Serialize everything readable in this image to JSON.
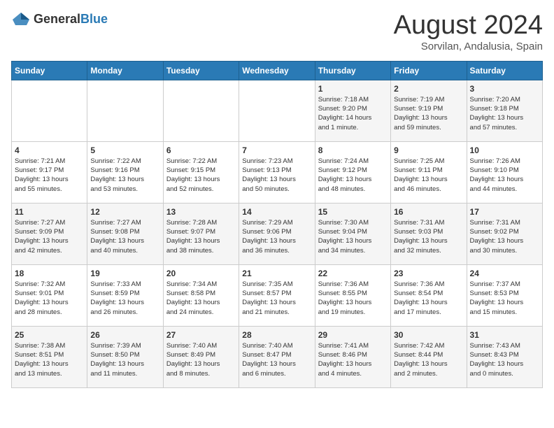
{
  "logo": {
    "text_general": "General",
    "text_blue": "Blue"
  },
  "title": "August 2024",
  "subtitle": "Sorvilan, Andalusia, Spain",
  "days_of_week": [
    "Sunday",
    "Monday",
    "Tuesday",
    "Wednesday",
    "Thursday",
    "Friday",
    "Saturday"
  ],
  "weeks": [
    [
      {
        "day": "",
        "info": ""
      },
      {
        "day": "",
        "info": ""
      },
      {
        "day": "",
        "info": ""
      },
      {
        "day": "",
        "info": ""
      },
      {
        "day": "1",
        "info": "Sunrise: 7:18 AM\nSunset: 9:20 PM\nDaylight: 14 hours\nand 1 minute."
      },
      {
        "day": "2",
        "info": "Sunrise: 7:19 AM\nSunset: 9:19 PM\nDaylight: 13 hours\nand 59 minutes."
      },
      {
        "day": "3",
        "info": "Sunrise: 7:20 AM\nSunset: 9:18 PM\nDaylight: 13 hours\nand 57 minutes."
      }
    ],
    [
      {
        "day": "4",
        "info": "Sunrise: 7:21 AM\nSunset: 9:17 PM\nDaylight: 13 hours\nand 55 minutes."
      },
      {
        "day": "5",
        "info": "Sunrise: 7:22 AM\nSunset: 9:16 PM\nDaylight: 13 hours\nand 53 minutes."
      },
      {
        "day": "6",
        "info": "Sunrise: 7:22 AM\nSunset: 9:15 PM\nDaylight: 13 hours\nand 52 minutes."
      },
      {
        "day": "7",
        "info": "Sunrise: 7:23 AM\nSunset: 9:13 PM\nDaylight: 13 hours\nand 50 minutes."
      },
      {
        "day": "8",
        "info": "Sunrise: 7:24 AM\nSunset: 9:12 PM\nDaylight: 13 hours\nand 48 minutes."
      },
      {
        "day": "9",
        "info": "Sunrise: 7:25 AM\nSunset: 9:11 PM\nDaylight: 13 hours\nand 46 minutes."
      },
      {
        "day": "10",
        "info": "Sunrise: 7:26 AM\nSunset: 9:10 PM\nDaylight: 13 hours\nand 44 minutes."
      }
    ],
    [
      {
        "day": "11",
        "info": "Sunrise: 7:27 AM\nSunset: 9:09 PM\nDaylight: 13 hours\nand 42 minutes."
      },
      {
        "day": "12",
        "info": "Sunrise: 7:27 AM\nSunset: 9:08 PM\nDaylight: 13 hours\nand 40 minutes."
      },
      {
        "day": "13",
        "info": "Sunrise: 7:28 AM\nSunset: 9:07 PM\nDaylight: 13 hours\nand 38 minutes."
      },
      {
        "day": "14",
        "info": "Sunrise: 7:29 AM\nSunset: 9:06 PM\nDaylight: 13 hours\nand 36 minutes."
      },
      {
        "day": "15",
        "info": "Sunrise: 7:30 AM\nSunset: 9:04 PM\nDaylight: 13 hours\nand 34 minutes."
      },
      {
        "day": "16",
        "info": "Sunrise: 7:31 AM\nSunset: 9:03 PM\nDaylight: 13 hours\nand 32 minutes."
      },
      {
        "day": "17",
        "info": "Sunrise: 7:31 AM\nSunset: 9:02 PM\nDaylight: 13 hours\nand 30 minutes."
      }
    ],
    [
      {
        "day": "18",
        "info": "Sunrise: 7:32 AM\nSunset: 9:01 PM\nDaylight: 13 hours\nand 28 minutes."
      },
      {
        "day": "19",
        "info": "Sunrise: 7:33 AM\nSunset: 8:59 PM\nDaylight: 13 hours\nand 26 minutes."
      },
      {
        "day": "20",
        "info": "Sunrise: 7:34 AM\nSunset: 8:58 PM\nDaylight: 13 hours\nand 24 minutes."
      },
      {
        "day": "21",
        "info": "Sunrise: 7:35 AM\nSunset: 8:57 PM\nDaylight: 13 hours\nand 21 minutes."
      },
      {
        "day": "22",
        "info": "Sunrise: 7:36 AM\nSunset: 8:55 PM\nDaylight: 13 hours\nand 19 minutes."
      },
      {
        "day": "23",
        "info": "Sunrise: 7:36 AM\nSunset: 8:54 PM\nDaylight: 13 hours\nand 17 minutes."
      },
      {
        "day": "24",
        "info": "Sunrise: 7:37 AM\nSunset: 8:53 PM\nDaylight: 13 hours\nand 15 minutes."
      }
    ],
    [
      {
        "day": "25",
        "info": "Sunrise: 7:38 AM\nSunset: 8:51 PM\nDaylight: 13 hours\nand 13 minutes."
      },
      {
        "day": "26",
        "info": "Sunrise: 7:39 AM\nSunset: 8:50 PM\nDaylight: 13 hours\nand 11 minutes."
      },
      {
        "day": "27",
        "info": "Sunrise: 7:40 AM\nSunset: 8:49 PM\nDaylight: 13 hours\nand 8 minutes."
      },
      {
        "day": "28",
        "info": "Sunrise: 7:40 AM\nSunset: 8:47 PM\nDaylight: 13 hours\nand 6 minutes."
      },
      {
        "day": "29",
        "info": "Sunrise: 7:41 AM\nSunset: 8:46 PM\nDaylight: 13 hours\nand 4 minutes."
      },
      {
        "day": "30",
        "info": "Sunrise: 7:42 AM\nSunset: 8:44 PM\nDaylight: 13 hours\nand 2 minutes."
      },
      {
        "day": "31",
        "info": "Sunrise: 7:43 AM\nSunset: 8:43 PM\nDaylight: 13 hours\nand 0 minutes."
      }
    ]
  ]
}
